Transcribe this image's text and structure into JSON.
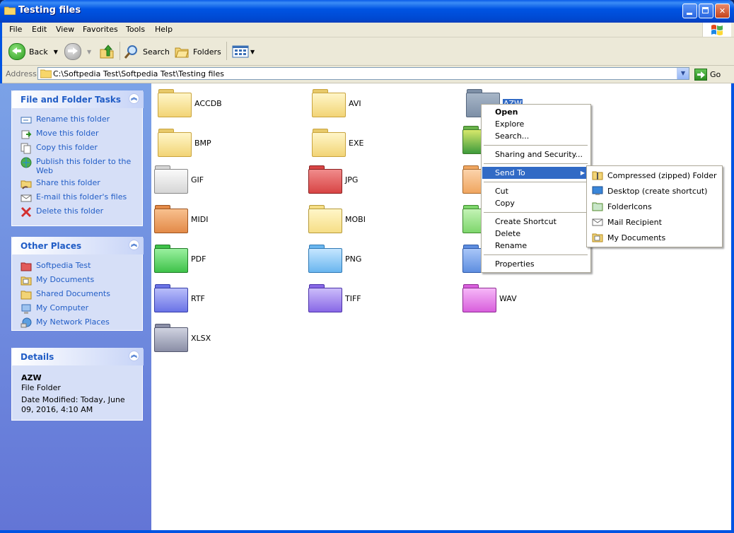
{
  "window": {
    "title": "Testing files"
  },
  "menubar": {
    "items": [
      "File",
      "Edit",
      "View",
      "Favorites",
      "Tools",
      "Help"
    ]
  },
  "toolbar": {
    "back": "Back",
    "search": "Search",
    "folders": "Folders"
  },
  "address": {
    "label": "Address",
    "value": "C:\\Softpedia Test\\Softpedia Test\\Testing files",
    "go": "Go"
  },
  "sidebar": {
    "tasks": {
      "title": "File and Folder Tasks",
      "items": [
        "Rename this folder",
        "Move this folder",
        "Copy this folder",
        "Publish this folder to the Web",
        "Share this folder",
        "E-mail this folder's files",
        "Delete this folder"
      ]
    },
    "places": {
      "title": "Other Places",
      "items": [
        "Softpedia Test",
        "My Documents",
        "Shared Documents",
        "My Computer",
        "My Network Places"
      ]
    },
    "details": {
      "title": "Details",
      "name": "AZW",
      "type": "File Folder",
      "modified": "Date Modified: Today, June 09, 2016, 4:10 AM"
    }
  },
  "folders": [
    {
      "name": "ACCDB",
      "color": "#f2d476"
    },
    {
      "name": "AVI",
      "color": "#f2d476"
    },
    {
      "name": "AZW",
      "color": "#8a9bb0"
    },
    {
      "name": "BMP",
      "color": "#f2d476"
    },
    {
      "name": "EXE",
      "color": "#f2d476"
    },
    {
      "name": "GIF",
      "color": "#e8e8e8"
    },
    {
      "name": "JPG",
      "color": "#e25b5b"
    },
    {
      "name": "MIDI",
      "color": "#f0a660"
    },
    {
      "name": "MOBI",
      "color": "#fbe69a"
    },
    {
      "name": "PDF",
      "color": "#64d66c"
    },
    {
      "name": "PNG",
      "color": "#88c6f4"
    },
    {
      "name": "RTF",
      "color": "#8c94f0"
    },
    {
      "name": "TIFF",
      "color": "#a38cf0"
    },
    {
      "name": "WAV",
      "color": "#e07fe4"
    },
    {
      "name": "XLSX",
      "color": "#a3a7bd"
    }
  ],
  "context_menu": {
    "open": "Open",
    "explore": "Explore",
    "search": "Search...",
    "sharing": "Sharing and Security...",
    "send_to": "Send To",
    "cut": "Cut",
    "copy": "Copy",
    "create_shortcut": "Create Shortcut",
    "delete": "Delete",
    "rename": "Rename",
    "properties": "Properties"
  },
  "send_to_menu": [
    "Compressed (zipped) Folder",
    "Desktop (create shortcut)",
    "FolderIcons",
    "Mail Recipient",
    "My Documents"
  ]
}
